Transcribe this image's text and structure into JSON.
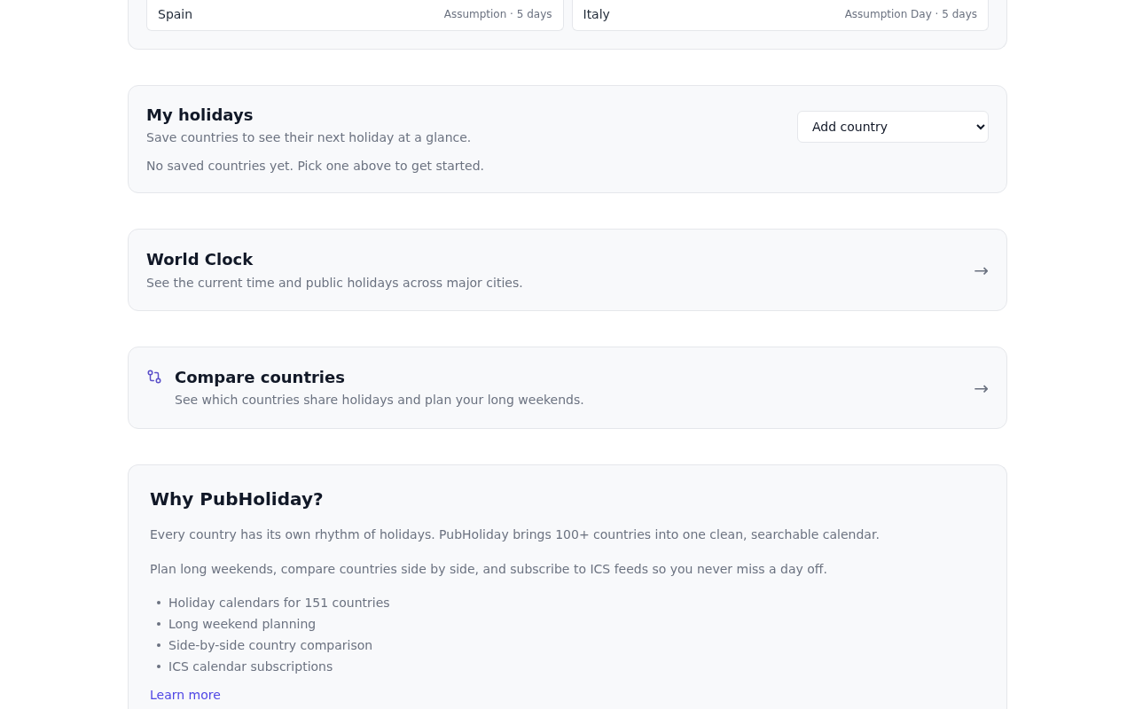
{
  "upcoming": {
    "countries": [
      {
        "name": "Spain",
        "holiday": "Assumption · 5 days"
      },
      {
        "name": "Italy",
        "holiday": "Assumption Day · 5 days"
      }
    ]
  },
  "my_holidays": {
    "title": "My holidays",
    "subtitle": "Save countries to see their next holiday at a glance.",
    "select": {
      "value": "Add country"
    },
    "empty_message": "No saved countries yet. Pick one above to get started."
  },
  "link_cards": [
    {
      "kind": "plain",
      "title": "World Clock",
      "description": "See the current time and public holidays across major cities.",
      "arrow": "→"
    },
    {
      "kind": "icon",
      "title": "Compare countries",
      "description": "See which countries share holidays and plan your long weekends.",
      "arrow": "→"
    }
  ],
  "why": {
    "title": "Why PubHoliday?",
    "paragraphs": [
      "Every country has its own rhythm of holidays. PubHoliday brings 100+ countries into one clean, searchable calendar.",
      "Plan long weekends, compare countries side by side, and subscribe to ICS feeds so you never miss a day off."
    ],
    "features": [
      "Holiday calendars for 151 countries",
      "Long weekend planning",
      "Side-by-side country comparison",
      "ICS calendar subscriptions"
    ],
    "link": "Learn more"
  }
}
